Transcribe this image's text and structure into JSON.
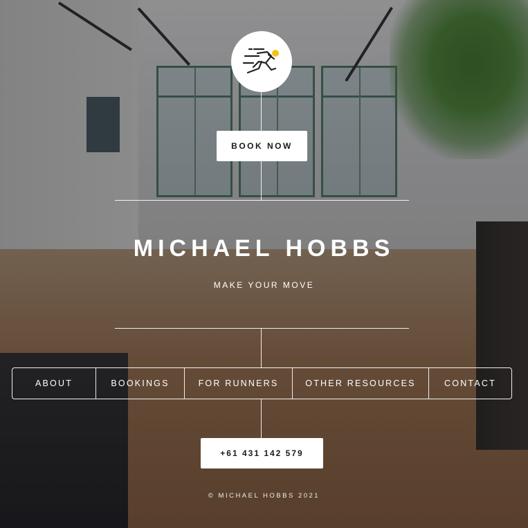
{
  "header": {
    "logo_icon": "running-man-icon",
    "book_now_label": "BOOK NOW"
  },
  "hero": {
    "title": "MICHAEL HOBBS",
    "tagline": "MAKE YOUR MOVE"
  },
  "nav": {
    "items": [
      {
        "label": "ABOUT"
      },
      {
        "label": "BOOKINGS"
      },
      {
        "label": "FOR RUNNERS"
      },
      {
        "label": "OTHER RESOURCES"
      },
      {
        "label": "CONTACT"
      }
    ]
  },
  "contact": {
    "phone": "+61 431 142 579"
  },
  "footer": {
    "copyright": "© MICHAEL HOBBS 2021"
  },
  "colors": {
    "overlay": "#141418",
    "button_bg": "#ffffff",
    "logo_accent": "#f2c21b"
  }
}
